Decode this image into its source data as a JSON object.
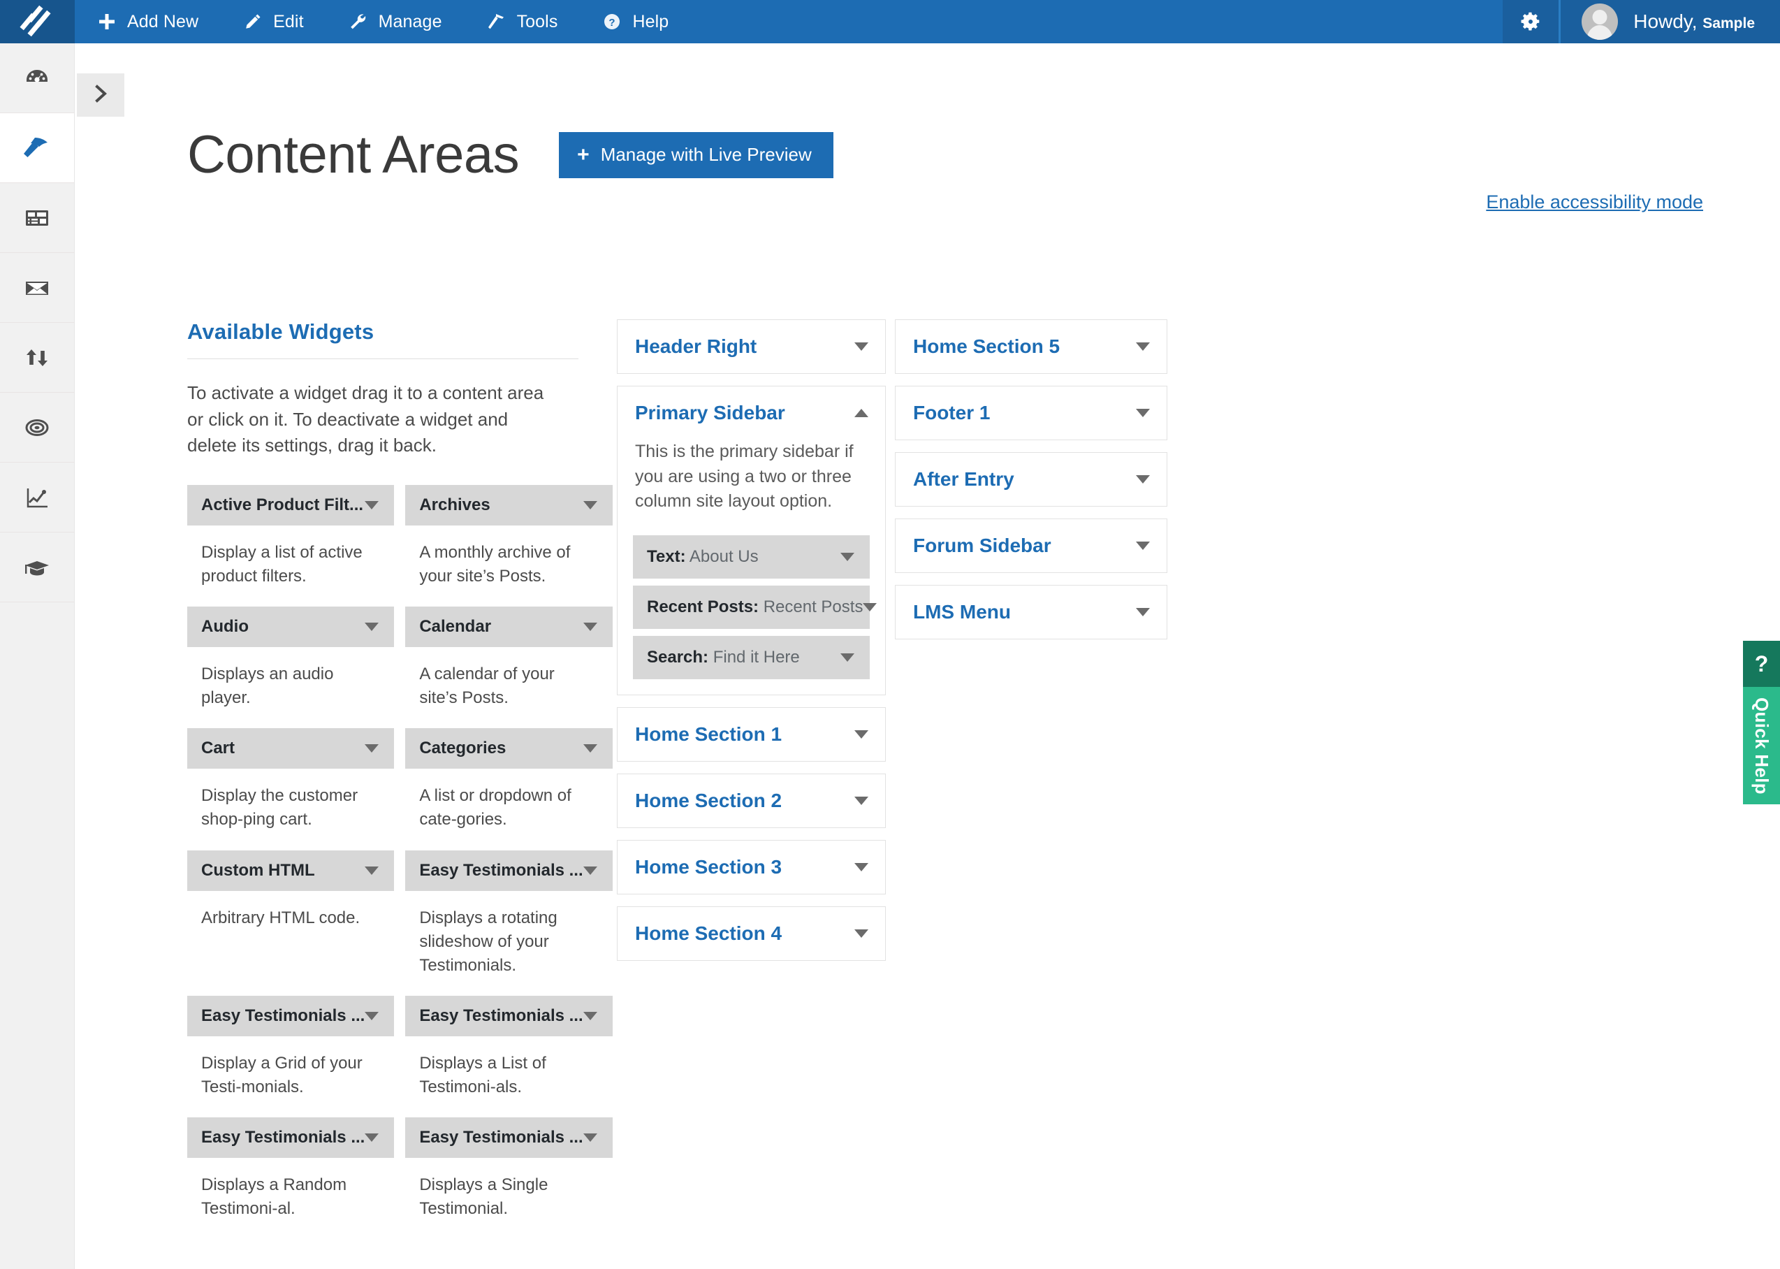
{
  "adminbar": {
    "logo_icon": "slashes-logo-icon",
    "menu": [
      {
        "label": "Add New",
        "icon": "plus-icon"
      },
      {
        "label": "Edit",
        "icon": "pencil-icon"
      },
      {
        "label": "Manage",
        "icon": "wrench-icon"
      },
      {
        "label": "Tools",
        "icon": "hammer-icon"
      },
      {
        "label": "Help",
        "icon": "question-circle-icon"
      }
    ],
    "settings_icon": "gear-icon",
    "greeting": "Howdy,",
    "username": "Sample"
  },
  "rail": {
    "items": [
      {
        "name": "dashboard",
        "icon": "gauge-icon",
        "active": false
      },
      {
        "name": "appearance",
        "icon": "hammer-icon",
        "active": true
      },
      {
        "name": "layouts",
        "icon": "layout-icon",
        "active": false
      },
      {
        "name": "mail",
        "icon": "envelope-icon",
        "active": false
      },
      {
        "name": "transfer",
        "icon": "up-down-arrows-icon",
        "active": false
      },
      {
        "name": "targets",
        "icon": "target-icon",
        "active": false
      },
      {
        "name": "analytics",
        "icon": "chart-line-icon",
        "active": false
      },
      {
        "name": "courses",
        "icon": "graduation-cap-icon",
        "active": false
      }
    ],
    "toggle_icon": "chevron-right-icon"
  },
  "page": {
    "title": "Content Areas",
    "live_preview_button": "Manage with Live Preview",
    "live_preview_icon": "plus-icon",
    "accessibility_link": "Enable accessibility mode"
  },
  "available": {
    "heading": "Available Widgets",
    "description": "To activate a widget drag it to a content area or click on it. To deactivate a widget and delete its settings, drag it back.",
    "widgets": [
      {
        "name": "Active Product Filt...",
        "desc": "Display a list of active product filters."
      },
      {
        "name": "Archives",
        "desc": "A monthly archive of your site’s Posts."
      },
      {
        "name": "Audio",
        "desc": "Displays an audio player."
      },
      {
        "name": "Calendar",
        "desc": "A calendar of your site’s Posts."
      },
      {
        "name": "Cart",
        "desc": "Display the customer shop-ping cart."
      },
      {
        "name": "Categories",
        "desc": "A list or dropdown of cate-gories."
      },
      {
        "name": "Custom HTML",
        "desc": "Arbitrary HTML code."
      },
      {
        "name": "Easy Testimonials ...",
        "desc": "Displays a rotating slideshow of your Testimonials."
      },
      {
        "name": "Easy Testimonials ...",
        "desc": "Display a Grid of your Testi-monials."
      },
      {
        "name": "Easy Testimonials ...",
        "desc": "Displays a List of Testimoni-als."
      },
      {
        "name": "Easy Testimonials ...",
        "desc": "Displays a Random Testimoni-al."
      },
      {
        "name": "Easy Testimonials ...",
        "desc": "Displays a Single Testimonial."
      }
    ]
  },
  "areas_middle": [
    {
      "title": "Header Right",
      "expanded": false,
      "desc": null,
      "widgets": []
    },
    {
      "title": "Primary Sidebar",
      "expanded": true,
      "desc": "This is the primary sidebar if you are using a two or three column site layout option.",
      "widgets": [
        {
          "type": "Text:",
          "value": "About Us"
        },
        {
          "type": "Recent Posts:",
          "value": "Recent Posts"
        },
        {
          "type": "Search:",
          "value": "Find it Here"
        }
      ]
    },
    {
      "title": "Home Section 1",
      "expanded": false,
      "desc": null,
      "widgets": []
    },
    {
      "title": "Home Section 2",
      "expanded": false,
      "desc": null,
      "widgets": []
    },
    {
      "title": "Home Section 3",
      "expanded": false,
      "desc": null,
      "widgets": []
    },
    {
      "title": "Home Section 4",
      "expanded": false,
      "desc": null,
      "widgets": []
    }
  ],
  "areas_right": [
    {
      "title": "Home Section 5",
      "expanded": false,
      "desc": null,
      "widgets": []
    },
    {
      "title": "Footer 1",
      "expanded": false,
      "desc": null,
      "widgets": []
    },
    {
      "title": "After Entry",
      "expanded": false,
      "desc": null,
      "widgets": []
    },
    {
      "title": "Forum Sidebar",
      "expanded": false,
      "desc": null,
      "widgets": []
    },
    {
      "title": "LMS Menu",
      "expanded": false,
      "desc": null,
      "widgets": []
    }
  ],
  "quick_help": {
    "icon_label": "?",
    "label": "Quick Help"
  },
  "colors": {
    "adminbar": "#1d6cb3",
    "logo_bg": "#17558d",
    "accent_link": "#1d6cb3",
    "widget_bar": "#d7d7d7",
    "quickhelp_top": "#15785c",
    "quickhelp_body": "#2bba8b"
  }
}
